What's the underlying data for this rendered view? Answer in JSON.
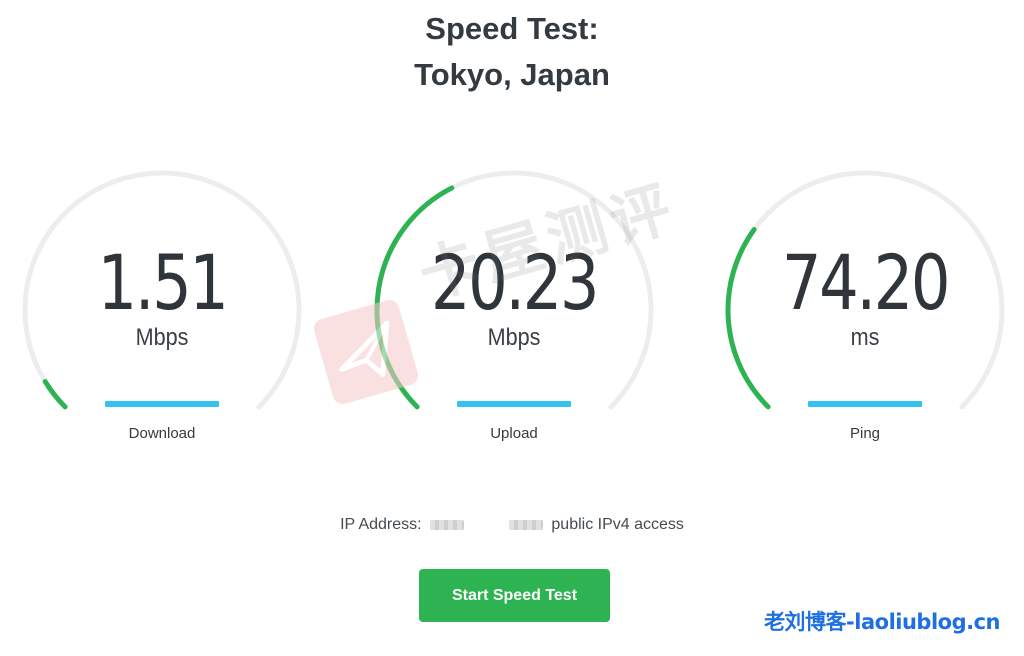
{
  "title": {
    "line1": "Speed Test:",
    "line2": "Tokyo, Japan"
  },
  "colors": {
    "track": "#ededed",
    "progress": "#2eb352",
    "bar": "#34c3ef",
    "button": "#2eb352"
  },
  "gauges": [
    {
      "value": "1.51",
      "unit": "Mbps",
      "label": "Download",
      "fill_fraction": 0.05
    },
    {
      "value": "20.23",
      "unit": "Mbps",
      "label": "Upload",
      "fill_fraction": 0.4
    },
    {
      "value": "74.20",
      "unit": "ms",
      "label": "Ping",
      "fill_fraction": 0.3
    }
  ],
  "ip": {
    "label": "IP Address:",
    "suffix": "public IPv4 access"
  },
  "start_button": {
    "label": "Start Speed Test"
  },
  "watermark": {
    "text": "卡屋测评",
    "icon": "paper-plane-icon"
  },
  "credit": {
    "text": "老刘博客-laoliublog.cn"
  }
}
